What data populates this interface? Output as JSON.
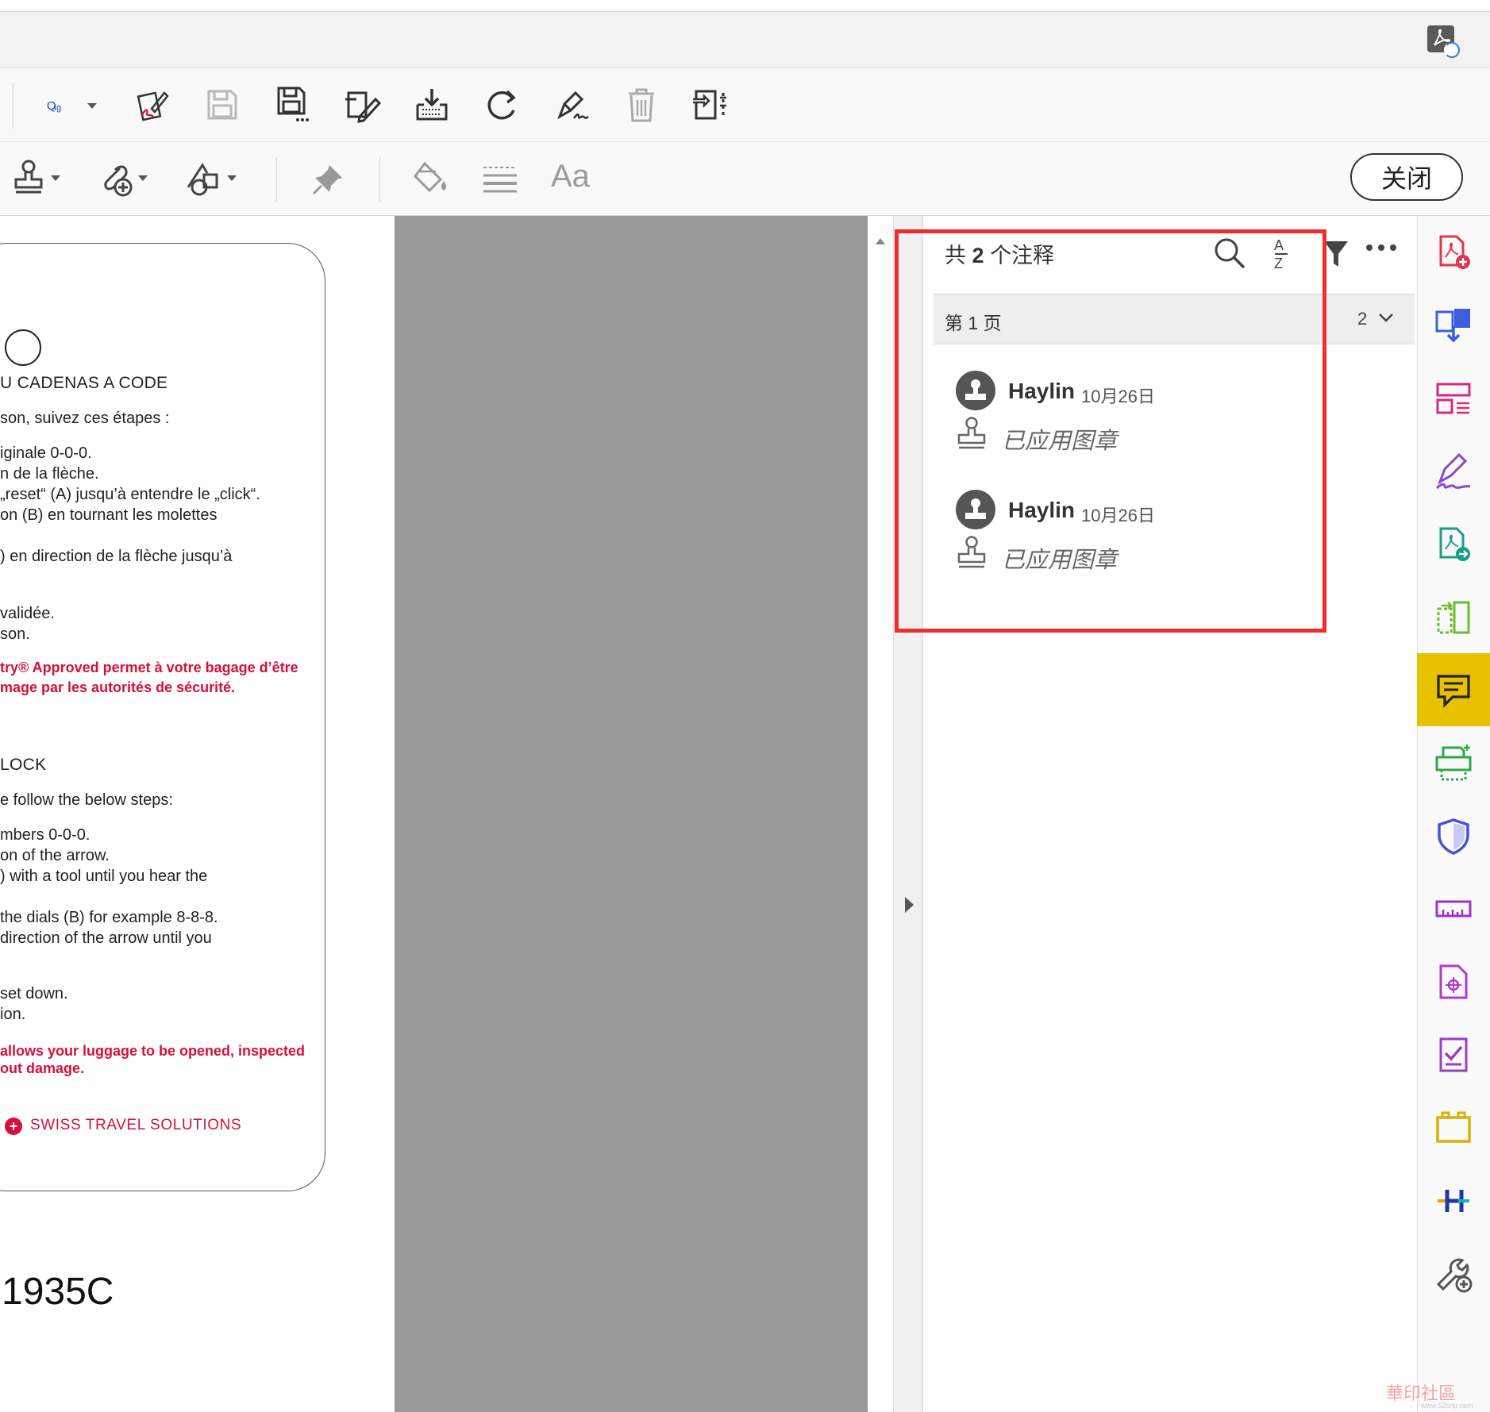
{
  "toolbar1": {
    "selector_icon": "text-select-icon",
    "tools": [
      "sign-pen-icon",
      "save-disabled-icon",
      "save-as-icon",
      "edit-pdf-icon",
      "download-icon",
      "redo-icon",
      "signature-icon",
      "delete-icon",
      "export-page-icon"
    ]
  },
  "toolbar2": {
    "tools": [
      "stamp-icon",
      "attach-icon",
      "shapes-icon",
      "pin-icon",
      "fill-icon",
      "lines-icon"
    ],
    "text_tool_label": "Aa",
    "close_label": "关闭"
  },
  "document": {
    "lines": [
      {
        "text": "U CADENAS A CODE",
        "style": "head"
      },
      {
        "text": "son, suivez ces étapes :",
        "style": "normal"
      },
      {
        "text": "iginale 0-0-0.",
        "style": "normal"
      },
      {
        "text": "n de la flèche.",
        "style": "normal"
      },
      {
        "text": "„reset“ (A) jusqu’à entendre le „click“.",
        "style": "normal"
      },
      {
        "text": "on (B) en tournant les molettes",
        "style": "normal"
      },
      {
        "text": ") en direction de la flèche jusqu’à",
        "style": "normal"
      },
      {
        "text": "validée.",
        "style": "normal"
      },
      {
        "text": "son.",
        "style": "normal"
      },
      {
        "text": "try® Approved permet à votre bagage d’être",
        "style": "red"
      },
      {
        "text": "mage par les autorités de sécurité.",
        "style": "red"
      },
      {
        "text": "LOCK",
        "style": "head"
      },
      {
        "text": "e follow the below steps:",
        "style": "normal"
      },
      {
        "text": "mbers 0-0-0.",
        "style": "normal"
      },
      {
        "text": "on of the arrow.",
        "style": "normal"
      },
      {
        "text": ") with a tool until you hear the",
        "style": "normal"
      },
      {
        "text": "the dials (B) for example 8-8-8.",
        "style": "normal"
      },
      {
        "text": "direction of the arrow until you",
        "style": "normal"
      },
      {
        "text": "set down.",
        "style": "normal"
      },
      {
        "text": "ion.",
        "style": "normal"
      },
      {
        "text": "allows your luggage to be opened, inspected",
        "style": "red"
      },
      {
        "text": "out damage.",
        "style": "red"
      }
    ],
    "brand": "SWISS TRAVEL SOLUTIONS",
    "brand_mark": "+",
    "model": "1935C"
  },
  "panel": {
    "title_prefix": "共",
    "title_count": "2",
    "title_suffix": "个注释",
    "group_label": "第 1 页",
    "group_count": "2",
    "comments": [
      {
        "author": "Haylin",
        "date": "10月26日",
        "text": "已应用图章"
      },
      {
        "author": "Haylin",
        "date": "10月26日",
        "text": "已应用图章"
      }
    ]
  },
  "sidebar": {
    "items": [
      "create-pdf-icon",
      "combine-files-icon",
      "organize-pages-icon",
      "fill-sign-icon",
      "export-pdf-icon",
      "edit-pdf-icon",
      "comment-icon",
      "scan-icon",
      "protect-icon",
      "measure-icon",
      "print-production-icon",
      "prepare-form-icon",
      "rich-media-icon",
      "index-icon",
      "more-tools-icon"
    ],
    "active": "comment-icon"
  },
  "colors": {
    "accent_red": "#d6103a",
    "highlight": "#f02d2d",
    "active_tool": "#e8c200"
  },
  "watermark": {
    "main": "華印社區",
    "sub": "www.52cnp.com"
  }
}
